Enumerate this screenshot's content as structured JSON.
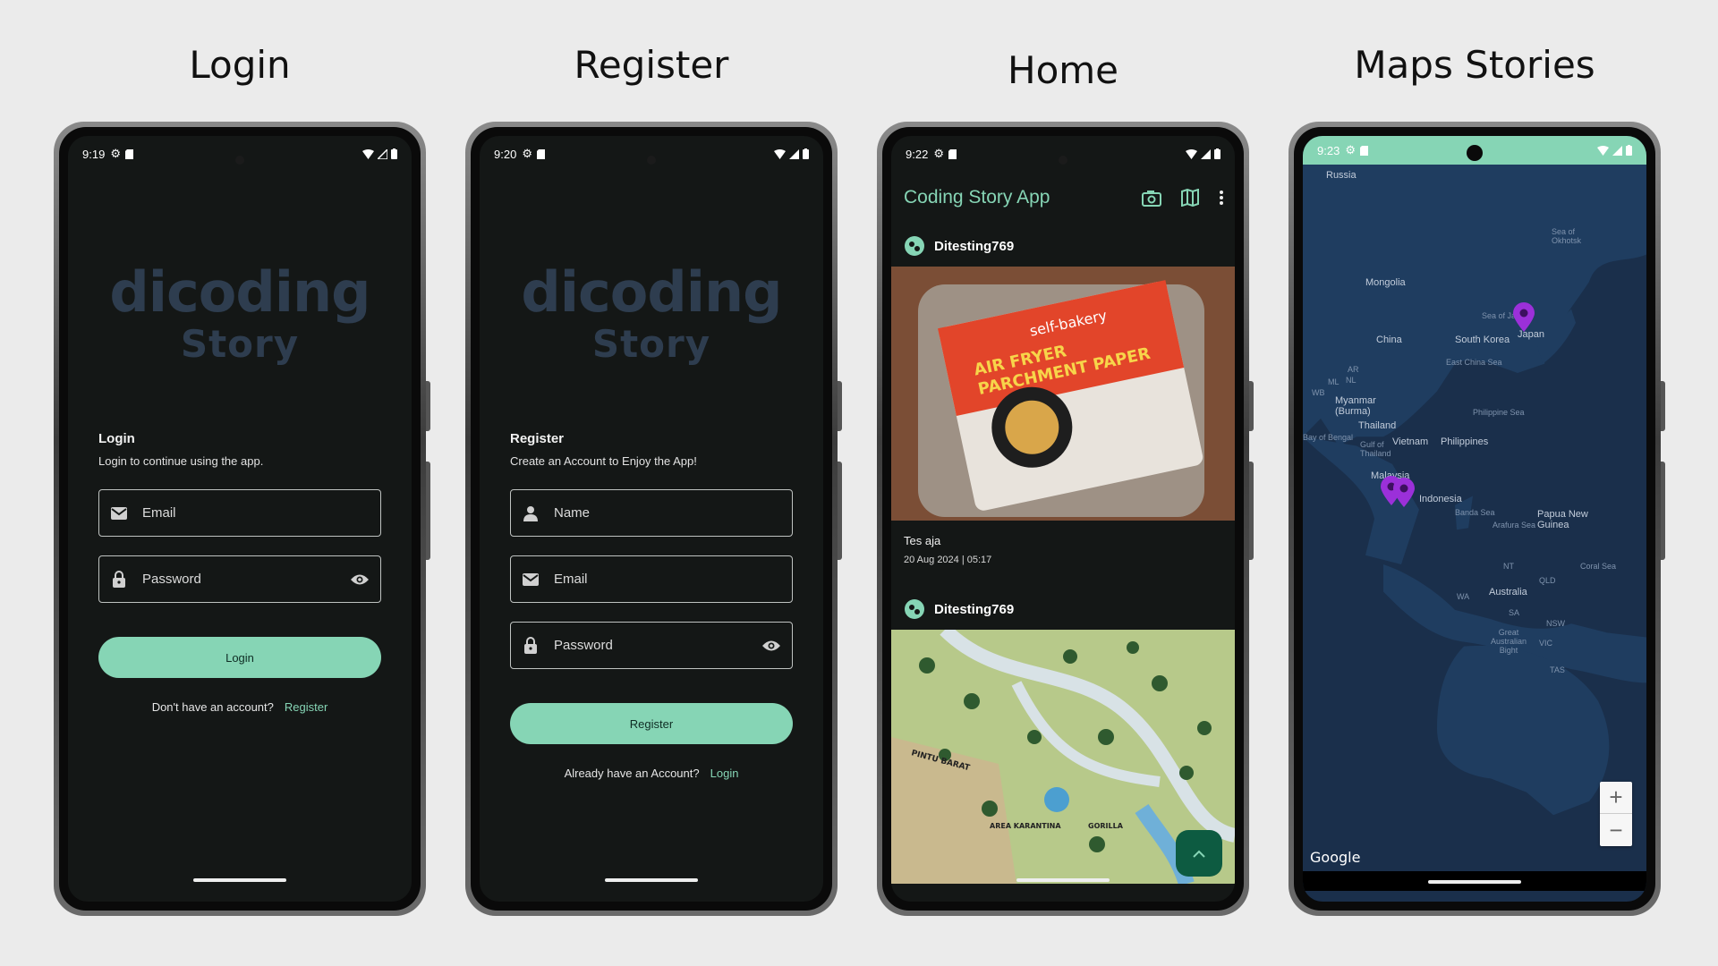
{
  "titles": [
    "Login",
    "Register",
    "Home",
    "Maps Stories"
  ],
  "login": {
    "time": "9:19",
    "logo_line1": "dicoding",
    "logo_line2": "Story",
    "heading": "Login",
    "subheading": "Login to continue using the app.",
    "email_placeholder": "Email",
    "password_placeholder": "Password",
    "button": "Login",
    "prompt": "Don't have an account?",
    "link": "Register"
  },
  "register": {
    "time": "9:20",
    "logo_line1": "dicoding",
    "logo_line2": "Story",
    "heading": "Register",
    "subheading": "Create an Account to Enjoy the App!",
    "name_placeholder": "Name",
    "email_placeholder": "Email",
    "password_placeholder": "Password",
    "button": "Register",
    "prompt": "Already have an Account?",
    "link": "Login"
  },
  "home": {
    "time": "9:22",
    "app_title": "Coding Story App",
    "stories": [
      {
        "user": "Ditesting769",
        "description": "Tes aja",
        "date": "20 Aug 2024 | 05:17",
        "photo_text": [
          "self-bakery",
          "AIR FRYER",
          "PARCHMENT PAPER"
        ]
      },
      {
        "user": "Ditesting769",
        "photo_text": [
          "PINTU BARAT",
          "AREA KARANTINA",
          "GORILLA"
        ]
      }
    ]
  },
  "maps": {
    "time": "9:23",
    "labels": [
      "Russia",
      "Mongolia",
      "China",
      "South Korea",
      "Japan",
      "Myanmar (Burma)",
      "Thailand",
      "Vietnam",
      "Philippines",
      "Malaysia",
      "Indonesia",
      "Papua New Guinea",
      "Australia",
      "NT",
      "QLD",
      "WA",
      "SA",
      "NSW",
      "VIC",
      "TAS",
      "AR",
      "ML",
      "NL",
      "WB"
    ],
    "sea_labels": [
      "Sea of Okhotsk",
      "Sea of Japan",
      "East China Sea",
      "Philippine Sea",
      "Bay of Bengal",
      "Gulf of Thailand",
      "Banda Sea",
      "Arafura Sea",
      "Coral Sea",
      "Great Australian Bight"
    ],
    "zoom_in": "+",
    "zoom_out": "−",
    "attribution": "Google"
  },
  "colors": {
    "accent": "#86d5b5",
    "screen_bg": "#141716",
    "map_bg": "#1a2f4b",
    "marker": "#9b30d9"
  }
}
